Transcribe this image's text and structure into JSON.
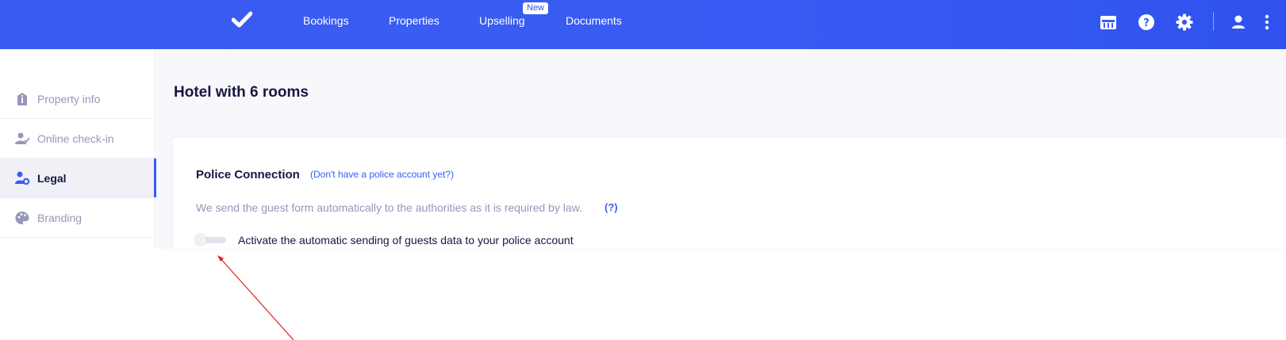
{
  "header": {
    "nav": [
      {
        "label": "Bookings"
      },
      {
        "label": "Properties"
      },
      {
        "label": "Upselling",
        "badge": "New"
      },
      {
        "label": "Documents"
      }
    ],
    "icons": [
      "calendar-icon",
      "help-icon",
      "gear-icon",
      "user-icon",
      "more-vertical-icon"
    ],
    "brand_color": "#385cf3"
  },
  "sidebar": {
    "items": [
      {
        "label": "Property info",
        "icon": "property-info-icon"
      },
      {
        "label": "Online check-in",
        "icon": "user-check-icon"
      },
      {
        "label": "Legal",
        "icon": "legal-icon",
        "active": true
      },
      {
        "label": "Branding",
        "icon": "palette-icon"
      }
    ]
  },
  "main": {
    "title": "Hotel with 6 rooms",
    "police": {
      "title": "Police Connection",
      "link": "(Don't have a police account yet?)",
      "description": "We send the guest form automatically to the authorities as it is required by law.",
      "help": "(?)",
      "toggle_label": "Activate the automatic sending of guests data to your police account",
      "toggle_on": false
    }
  },
  "annotation": {
    "color": "#e02020"
  }
}
